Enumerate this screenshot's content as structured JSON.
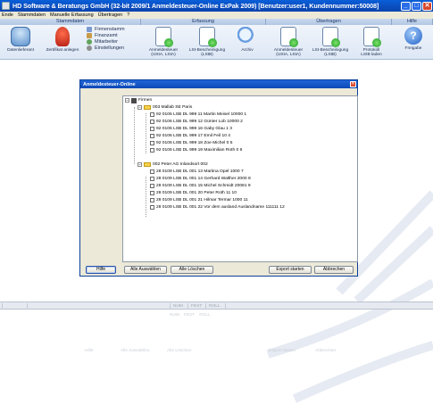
{
  "window": {
    "title": "HD Software & Beratungs GmbH (32-bit 2009/1 Anmeldesteuer-Online ExPak 2009) [Benutzer:user1, Kundennummer:50008]",
    "controls": {
      "minimize": "_",
      "maximize": "□",
      "close": "✕"
    }
  },
  "menu": [
    "Ende",
    "Stammdaten",
    "Manuelle Erfassung",
    "Übertragen",
    "?"
  ],
  "ribbon": {
    "groups": [
      "Stammdaten",
      "Erfassung",
      "Übertragen",
      "Hilfe"
    ],
    "buttons": {
      "datenlieferant": "Datenlieferant",
      "zertifikat": "Zertifikat anlegen",
      "anmeldesteuer": "Anmeldesteuer\n(UStA, LStA)",
      "lstb": "LSt-Bescheinigung\n(LStB)",
      "archiv": "Archiv",
      "anmeldesteuer_u": "Anmeldesteuer\n(UStA, LStA)",
      "lstb_u": "LSt-Bescheinigung\n(LStB)",
      "protokoll": "Protokoll\nLStB laden",
      "freigabe": "Freigabe"
    },
    "small_items": [
      "Firmenstamm",
      "Finanzamt",
      "Mitarbeiter",
      "Einstellungen"
    ],
    "help_icon_text": "?"
  },
  "dialog": {
    "title": "Anmeldesteuer-Online",
    "close": "✕",
    "tree": {
      "root": "Firmen",
      "firms": [
        {
          "label": "003 Mallab SE Paris",
          "entries": [
            "92 0106 LSB DL 999  11  Martin Meisel  10000  1",
            "92 0106 LSB DL 999  12  Günter Lob  10000  2",
            "92 0106 LSB DL 999  16  Gaby Glau  1  3",
            "92 0106 LSB DL 999  17  Emil Feil  10  4",
            "92 0106 LSB DL 999  18  Zoe Michel  0  5",
            "92 0106 LSB DL 999  19  Maximilian Roth  0  6"
          ]
        },
        {
          "label": "002 Peter AG Inlandsort 002",
          "entries": [
            "28 0109 LSB DL 001  13  Martina Opel  1000  7",
            "28 0109 LSB DL 001  14  Gerhard Walther  2000  8",
            "28 0109 LSB DL 001  15  Michel Schmidt  20081  9",
            "28 0109 LSB DL 001  20  Peter Roth  11  10",
            "28 0109 LSB DL 001  21  Hilmar Termar  1000  11",
            "28 0109 LSB DL 001  22  Vor dem ausland Auslandname  111111  12"
          ]
        }
      ]
    },
    "buttons": {
      "hilfe": "Hilfe",
      "alle_auswaehlen": "Alle Auswählen",
      "alle_loeschen": "Alle Löschen",
      "export": "Export starten",
      "abbrechen": "Abbrechen"
    }
  },
  "statusbar": {
    "num": "NUM",
    "fest": "FEST",
    "roll": "ROLL"
  },
  "ghost_statusbar": {
    "num": "NUM",
    "fest": "FEST",
    "roll": "ROLL"
  },
  "ghost_buttons": [
    "Hilfe",
    "Alle Auswählen",
    "Alle Löschen",
    "Export starten",
    "Abbrechen"
  ],
  "colors": {
    "titlebar": "#0b4ec0",
    "dialog_bg": "#ece9d8",
    "folder": "#f7d24a"
  }
}
